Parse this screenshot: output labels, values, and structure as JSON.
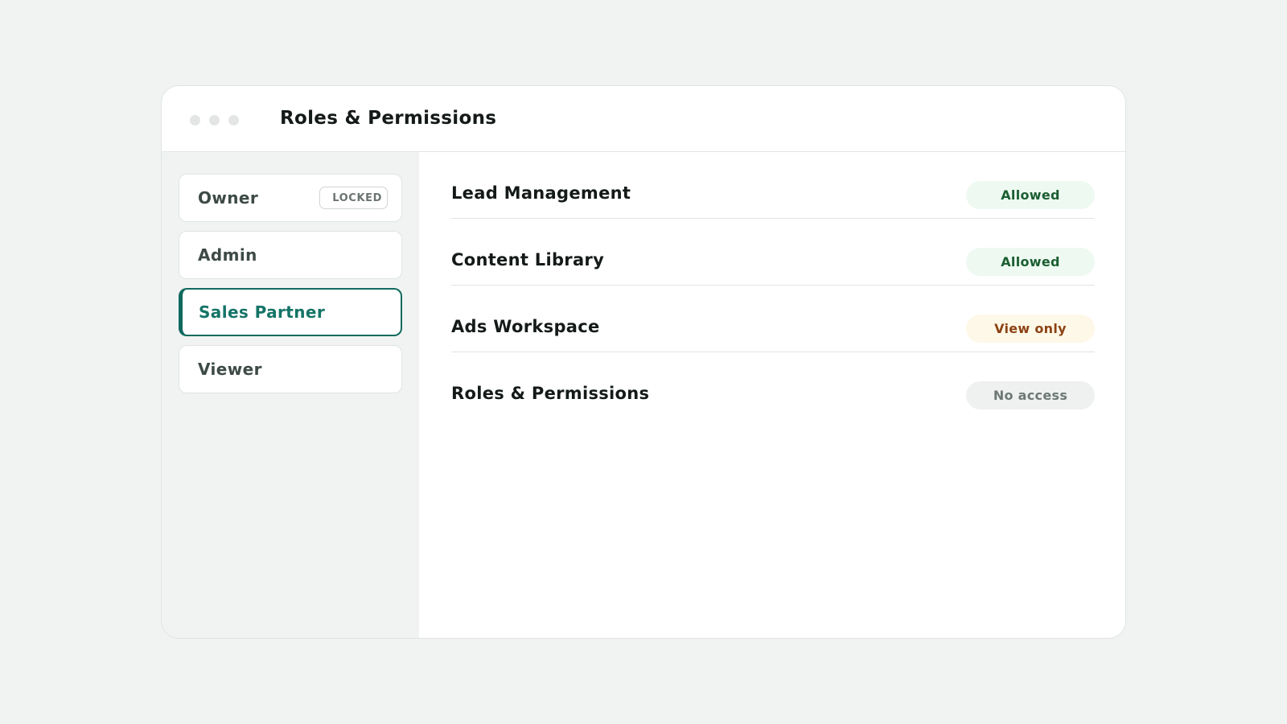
{
  "window": {
    "title": "Roles & Permissions"
  },
  "sidebar": {
    "roles": [
      {
        "label": "Owner",
        "badge": "LOCKED",
        "active": false
      },
      {
        "label": "Admin",
        "active": false
      },
      {
        "label": "Sales Partner",
        "active": true
      },
      {
        "label": "Viewer",
        "active": false
      }
    ]
  },
  "permissions": [
    {
      "name": "Lead Management",
      "status": "Allowed"
    },
    {
      "name": "Content Library",
      "status": "Allowed"
    },
    {
      "name": "Ads Workspace",
      "status": "View only"
    },
    {
      "name": "Roles & Permissions",
      "status": "No access"
    }
  ],
  "colors": {
    "accent": "#11695e",
    "allowed_bg": "#eef9f2",
    "allowed_text": "#1b5e31",
    "view_bg": "#fdf8e8",
    "view_text": "#8c4214",
    "none_bg": "#eef1f0",
    "none_text": "#6d7875"
  }
}
